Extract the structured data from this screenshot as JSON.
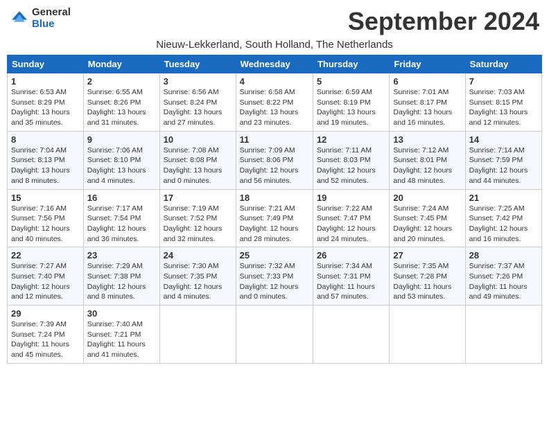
{
  "header": {
    "logo_general": "General",
    "logo_blue": "Blue",
    "month_title": "September 2024",
    "location": "Nieuw-Lekkerland, South Holland, The Netherlands"
  },
  "weekdays": [
    "Sunday",
    "Monday",
    "Tuesday",
    "Wednesday",
    "Thursday",
    "Friday",
    "Saturday"
  ],
  "weeks": [
    [
      {
        "day": "1",
        "info": "Sunrise: 6:53 AM\nSunset: 8:29 PM\nDaylight: 13 hours\nand 35 minutes."
      },
      {
        "day": "2",
        "info": "Sunrise: 6:55 AM\nSunset: 8:26 PM\nDaylight: 13 hours\nand 31 minutes."
      },
      {
        "day": "3",
        "info": "Sunrise: 6:56 AM\nSunset: 8:24 PM\nDaylight: 13 hours\nand 27 minutes."
      },
      {
        "day": "4",
        "info": "Sunrise: 6:58 AM\nSunset: 8:22 PM\nDaylight: 13 hours\nand 23 minutes."
      },
      {
        "day": "5",
        "info": "Sunrise: 6:59 AM\nSunset: 8:19 PM\nDaylight: 13 hours\nand 19 minutes."
      },
      {
        "day": "6",
        "info": "Sunrise: 7:01 AM\nSunset: 8:17 PM\nDaylight: 13 hours\nand 16 minutes."
      },
      {
        "day": "7",
        "info": "Sunrise: 7:03 AM\nSunset: 8:15 PM\nDaylight: 13 hours\nand 12 minutes."
      }
    ],
    [
      {
        "day": "8",
        "info": "Sunrise: 7:04 AM\nSunset: 8:13 PM\nDaylight: 13 hours\nand 8 minutes."
      },
      {
        "day": "9",
        "info": "Sunrise: 7:06 AM\nSunset: 8:10 PM\nDaylight: 13 hours\nand 4 minutes."
      },
      {
        "day": "10",
        "info": "Sunrise: 7:08 AM\nSunset: 8:08 PM\nDaylight: 13 hours\nand 0 minutes."
      },
      {
        "day": "11",
        "info": "Sunrise: 7:09 AM\nSunset: 8:06 PM\nDaylight: 12 hours\nand 56 minutes."
      },
      {
        "day": "12",
        "info": "Sunrise: 7:11 AM\nSunset: 8:03 PM\nDaylight: 12 hours\nand 52 minutes."
      },
      {
        "day": "13",
        "info": "Sunrise: 7:12 AM\nSunset: 8:01 PM\nDaylight: 12 hours\nand 48 minutes."
      },
      {
        "day": "14",
        "info": "Sunrise: 7:14 AM\nSunset: 7:59 PM\nDaylight: 12 hours\nand 44 minutes."
      }
    ],
    [
      {
        "day": "15",
        "info": "Sunrise: 7:16 AM\nSunset: 7:56 PM\nDaylight: 12 hours\nand 40 minutes."
      },
      {
        "day": "16",
        "info": "Sunrise: 7:17 AM\nSunset: 7:54 PM\nDaylight: 12 hours\nand 36 minutes."
      },
      {
        "day": "17",
        "info": "Sunrise: 7:19 AM\nSunset: 7:52 PM\nDaylight: 12 hours\nand 32 minutes."
      },
      {
        "day": "18",
        "info": "Sunrise: 7:21 AM\nSunset: 7:49 PM\nDaylight: 12 hours\nand 28 minutes."
      },
      {
        "day": "19",
        "info": "Sunrise: 7:22 AM\nSunset: 7:47 PM\nDaylight: 12 hours\nand 24 minutes."
      },
      {
        "day": "20",
        "info": "Sunrise: 7:24 AM\nSunset: 7:45 PM\nDaylight: 12 hours\nand 20 minutes."
      },
      {
        "day": "21",
        "info": "Sunrise: 7:25 AM\nSunset: 7:42 PM\nDaylight: 12 hours\nand 16 minutes."
      }
    ],
    [
      {
        "day": "22",
        "info": "Sunrise: 7:27 AM\nSunset: 7:40 PM\nDaylight: 12 hours\nand 12 minutes."
      },
      {
        "day": "23",
        "info": "Sunrise: 7:29 AM\nSunset: 7:38 PM\nDaylight: 12 hours\nand 8 minutes."
      },
      {
        "day": "24",
        "info": "Sunrise: 7:30 AM\nSunset: 7:35 PM\nDaylight: 12 hours\nand 4 minutes."
      },
      {
        "day": "25",
        "info": "Sunrise: 7:32 AM\nSunset: 7:33 PM\nDaylight: 12 hours\nand 0 minutes."
      },
      {
        "day": "26",
        "info": "Sunrise: 7:34 AM\nSunset: 7:31 PM\nDaylight: 11 hours\nand 57 minutes."
      },
      {
        "day": "27",
        "info": "Sunrise: 7:35 AM\nSunset: 7:28 PM\nDaylight: 11 hours\nand 53 minutes."
      },
      {
        "day": "28",
        "info": "Sunrise: 7:37 AM\nSunset: 7:26 PM\nDaylight: 11 hours\nand 49 minutes."
      }
    ],
    [
      {
        "day": "29",
        "info": "Sunrise: 7:39 AM\nSunset: 7:24 PM\nDaylight: 11 hours\nand 45 minutes."
      },
      {
        "day": "30",
        "info": "Sunrise: 7:40 AM\nSunset: 7:21 PM\nDaylight: 11 hours\nand 41 minutes."
      },
      null,
      null,
      null,
      null,
      null
    ]
  ]
}
